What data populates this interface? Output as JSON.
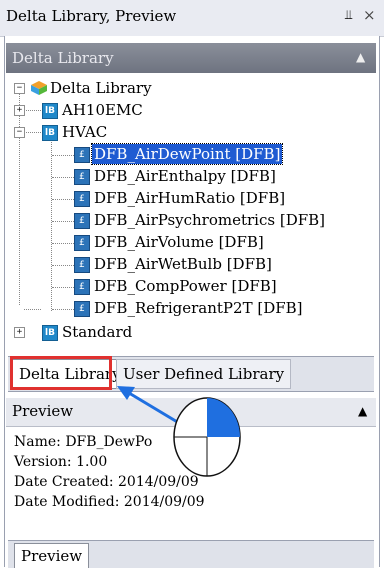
{
  "window": {
    "title": "Delta Library, Preview",
    "pin_glyph": "↓",
    "close_glyph": "×"
  },
  "library_panel": {
    "header": "Delta Library",
    "collapse_glyph": "▲"
  },
  "tree": {
    "root": {
      "label": "Delta Library",
      "icon": "cube-icon",
      "expanded": true
    },
    "nodes": [
      {
        "label": "AH10EMC",
        "icon": "package-icon",
        "expanded": false
      },
      {
        "label": "HVAC",
        "icon": "package-icon",
        "expanded": true
      },
      {
        "label": "DFB_AirDewPoint [DFB]",
        "icon": "dfb-icon",
        "selected": true
      },
      {
        "label": "DFB_AirEnthalpy [DFB]",
        "icon": "dfb-icon"
      },
      {
        "label": "DFB_AirHumRatio [DFB]",
        "icon": "dfb-icon"
      },
      {
        "label": "DFB_AirPsychrometrics [DFB]",
        "icon": "dfb-icon"
      },
      {
        "label": "DFB_AirVolume [DFB]",
        "icon": "dfb-icon"
      },
      {
        "label": "DFB_AirWetBulb [DFB]",
        "icon": "dfb-icon"
      },
      {
        "label": "DFB_CompPower [DFB]",
        "icon": "dfb-icon"
      },
      {
        "label": "DFB_RefrigerantP2T [DFB]",
        "icon": "dfb-icon"
      },
      {
        "label": "Standard",
        "icon": "package-icon",
        "expanded": false
      }
    ]
  },
  "tabs": [
    {
      "label": "Delta Library",
      "active": true
    },
    {
      "label": "User Defined Library",
      "active": false
    }
  ],
  "preview_panel": {
    "header": "Preview",
    "collapse_glyph": "▲",
    "lines": [
      "Name: DFB_DewPo",
      "Version: 1.00",
      "Date Created: 2014/09/09",
      "Date Modified: 2014/09/09"
    ]
  },
  "bottom_tabs": [
    {
      "label": "Preview"
    }
  ],
  "colors": {
    "selection": "#1f5bd2",
    "highlight_box": "#e0312f",
    "annotation": "#1f6fe0"
  }
}
